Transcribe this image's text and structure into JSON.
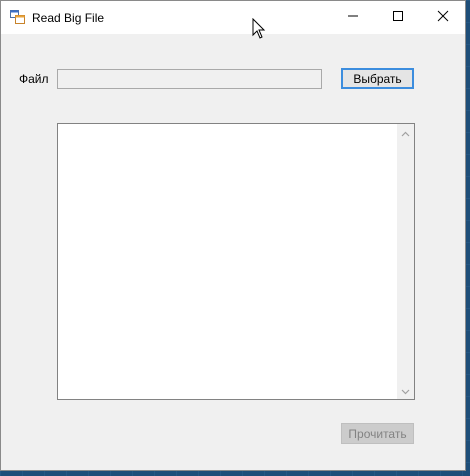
{
  "window": {
    "title": "Read Big File",
    "app_icon": "app-window-icon",
    "controls": {
      "minimize_icon": "minimize-icon",
      "maximize_icon": "maximize-icon",
      "close_icon": "close-icon"
    }
  },
  "form": {
    "file_label": "Файл",
    "file_value": "",
    "select_button": "Выбрать",
    "content_text": "",
    "read_button": "Прочитать",
    "read_button_enabled": false
  },
  "colors": {
    "window_bg": "#f0f0f0",
    "titlebar_bg": "#ffffff",
    "focus_border": "#3c8dde",
    "disabled_text": "#838383"
  }
}
